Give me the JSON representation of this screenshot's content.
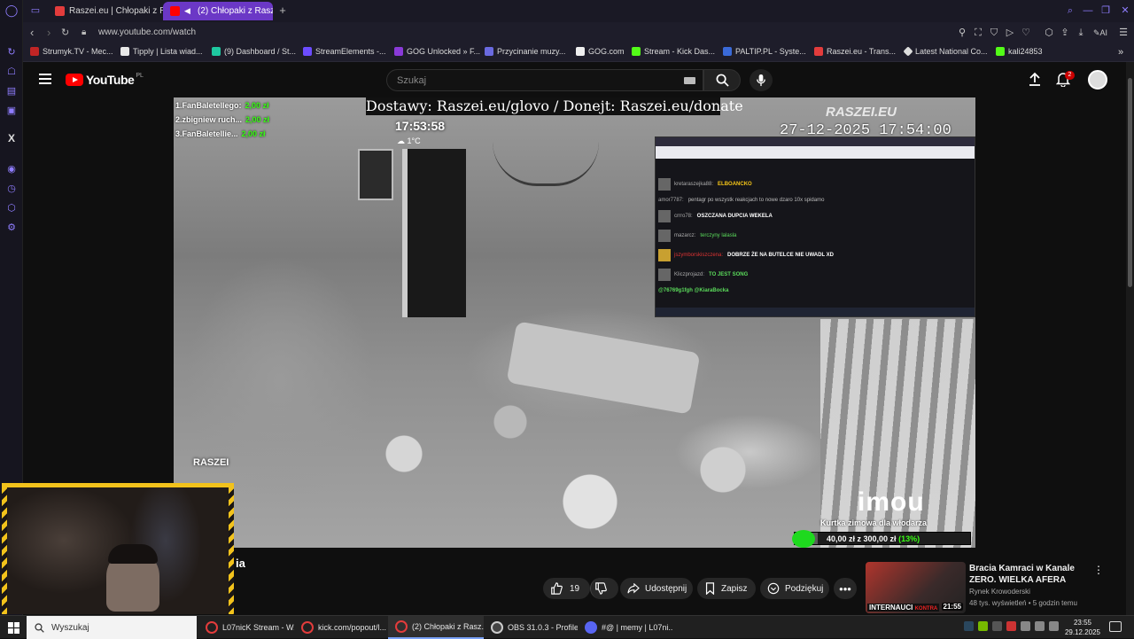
{
  "browser": {
    "tabs": [
      {
        "label": "Raszei.eu | Chłopaki z Ras",
        "favicon_color": "#e33c3c",
        "active": false
      },
      {
        "label": "(2) Chłopaki z Raszei -",
        "favicon_color": "#ff0000",
        "active": true
      }
    ],
    "url": "www.youtube.com/watch",
    "bookmarks": [
      {
        "label": "Strumyk.TV - Mec...",
        "color": "#c02525"
      },
      {
        "label": "Tipply | Lista wiad...",
        "color": "#e8e8e8"
      },
      {
        "label": "(9) Dashboard / St...",
        "color": "#1ec8a0"
      },
      {
        "label": "StreamElements -...",
        "color": "#6c4cff"
      },
      {
        "label": "GOG Unlocked » F...",
        "color": "#8a3ad8"
      },
      {
        "label": "Przycinanie muzy...",
        "color": "#6a6ae0"
      },
      {
        "label": "GOG.com",
        "color": "#eeeeee"
      },
      {
        "label": "Stream - Kick Das...",
        "color": "#53fc18"
      },
      {
        "label": "PALTIP.PL - Syste...",
        "color": "#3a6ad8"
      },
      {
        "label": "Raszei.eu - Trans...",
        "color": "#e33c3c"
      },
      {
        "label": "Latest National Co...",
        "color": "#dddddd"
      },
      {
        "label": "kali24853",
        "color": "#53fc18"
      }
    ]
  },
  "youtube": {
    "logo": "YouTube",
    "region": "PL",
    "search_placeholder": "Szukaj",
    "notifications_count": "2",
    "accent": "#ff0000"
  },
  "video": {
    "banner": "Dostawy: Raszei.eu/glovo / Donejt: Raszei.eu/donate",
    "clock": "17:53:58",
    "temperature": "1°C",
    "donors": [
      {
        "name": "1.FanBaletellego:",
        "amount": "2,00 zł"
      },
      {
        "name": "2.zbigniew ruch...",
        "amount": "2,00 zł"
      },
      {
        "name": "3.FanBaletellie...",
        "amount": "2,00 zł"
      }
    ],
    "cam_logo": "RASZEI.EU",
    "cam_datetime": "27-12-2025 17:54:00",
    "watermark": "RASZEI",
    "cam_brand": "imou",
    "goal": {
      "title": "Kurtka zimowa dla włodarza",
      "text": "40,00 zł z 300,00 zł",
      "percent_label": "(13%)",
      "fraction": 0.13
    },
    "chat": [
      {
        "user": "kretaraszejka88:",
        "text": "ELBOANCKO",
        "text_color": "#f5c518"
      },
      {
        "user": "amor7787:",
        "text": "pentagr po wszystk reakcjach to nowe dzaro 10x spidamo",
        "text_color": "#bbbbbb"
      },
      {
        "user": "crrro78:",
        "text": "OSZCZANA DUPCIA WEKELA",
        "text_color": "#ffffff"
      },
      {
        "user": "mazarcz:",
        "text": "terczyny lalasla",
        "text_color": "#5bdc5b"
      },
      {
        "user": "jszymborskiszczena:",
        "text": "DOBRZE ŻE NA BUTELCE NIE UWADL XD",
        "text_color": "#ffffff"
      },
      {
        "user": "Kliczprojazd:",
        "text": "TO JEST SONG",
        "text_color": "#5bdc5b"
      },
      {
        "user": "",
        "text": "@76769g1fgh @KiaraBocka",
        "text_color": "#5bdc5b"
      }
    ]
  },
  "title_tail": "ia",
  "actions": {
    "likes": "19",
    "share": "Udostępnij",
    "save": "Zapisz",
    "thanks": "Podziękuj"
  },
  "recommendation": {
    "title": "Bracia Kamraci w Kanale ZERO. WIELKA AFERA",
    "channel": "Rynek Krowoderski",
    "meta": "48 tys. wyświetleń • 5 godzin temu",
    "thumb_caption": "INTERNAUCI",
    "thumb_caption_2": "KONTRA",
    "duration": "21:55"
  },
  "taskbar": {
    "search": "Wyszukaj",
    "items": [
      {
        "label": "L07nicK Stream - W...",
        "color": "#e33c3c",
        "active": false
      },
      {
        "label": "kick.com/popout/l...",
        "color": "#e33c3c",
        "active": false
      },
      {
        "label": "(2) Chłopaki z Rasz...",
        "color": "#e33c3c",
        "active": true
      },
      {
        "label": "OBS 31.0.3 - Profile:...",
        "color": "#444444",
        "active": false
      },
      {
        "label": "#@ | memy | L07ni...",
        "color": "#5865f2",
        "active": false
      }
    ],
    "time": "23:55",
    "date": "29.12.2025"
  }
}
